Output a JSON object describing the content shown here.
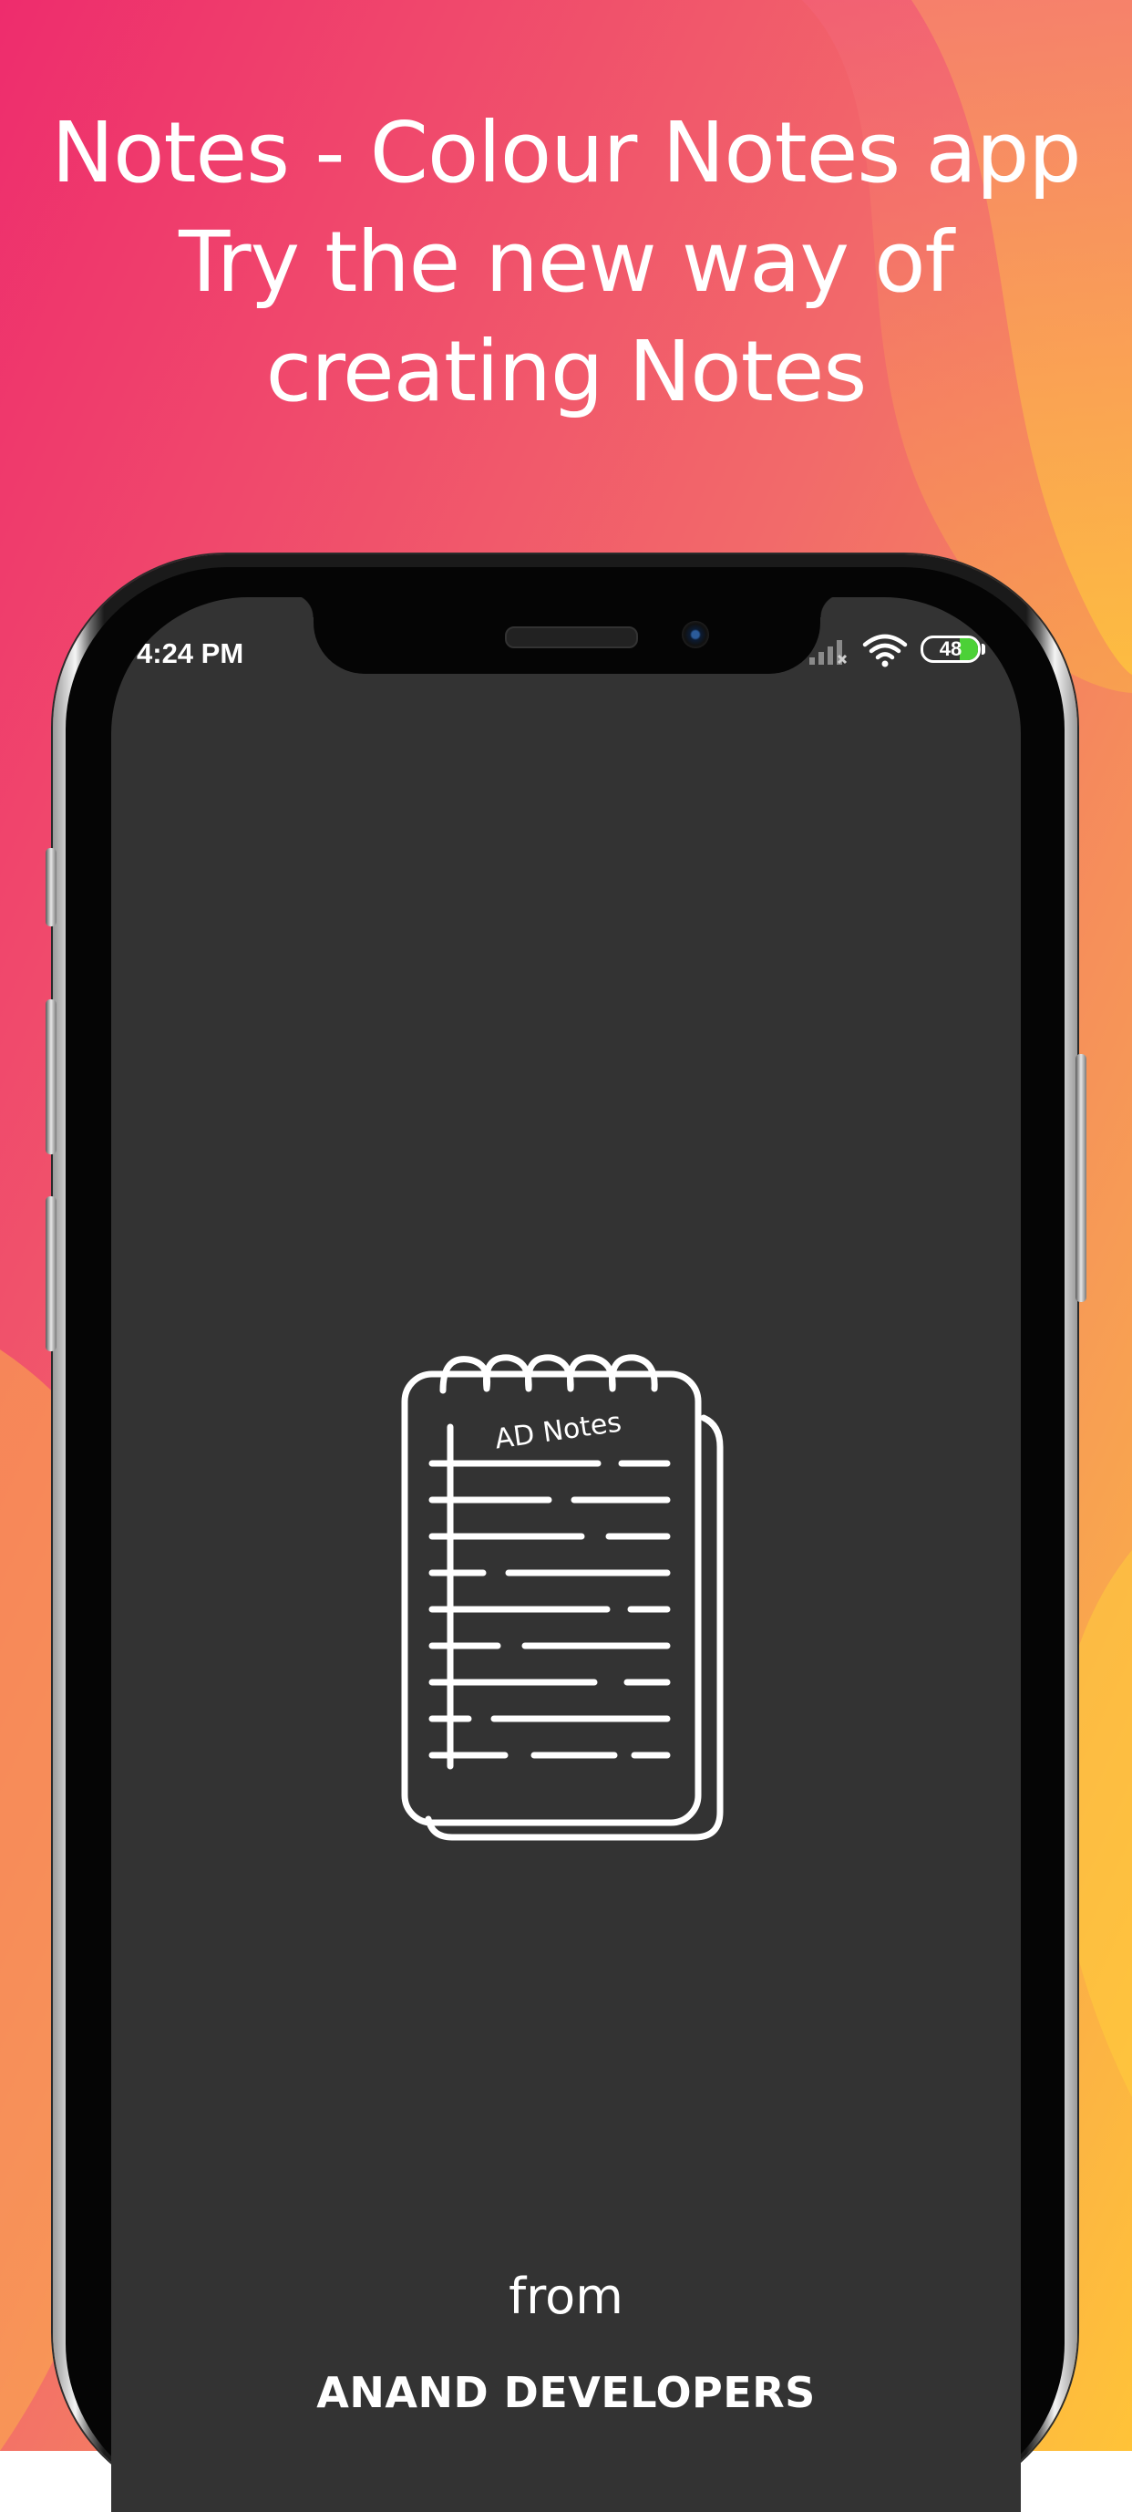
{
  "promo": {
    "headline_lines": [
      "Notes - Colour Notes app",
      "Try the new way of",
      "creating Notes"
    ]
  },
  "status_bar": {
    "time": "4:24 PM",
    "battery_level": "48",
    "icons": [
      "cellular-signal-icon",
      "wifi-icon",
      "battery-icon"
    ]
  },
  "splash": {
    "logo_text": "AD Notes",
    "logo_icon": "notepad-icon",
    "from_label": "from",
    "company_name": "ANAND DEVELOPERS"
  },
  "colors": {
    "bg_top_left": "#EE2C6D",
    "bg_bottom_right": "#FFC23A",
    "screen_bg": "#333333",
    "battery_fill": "#4CD137",
    "text": "#FFFFFF"
  }
}
